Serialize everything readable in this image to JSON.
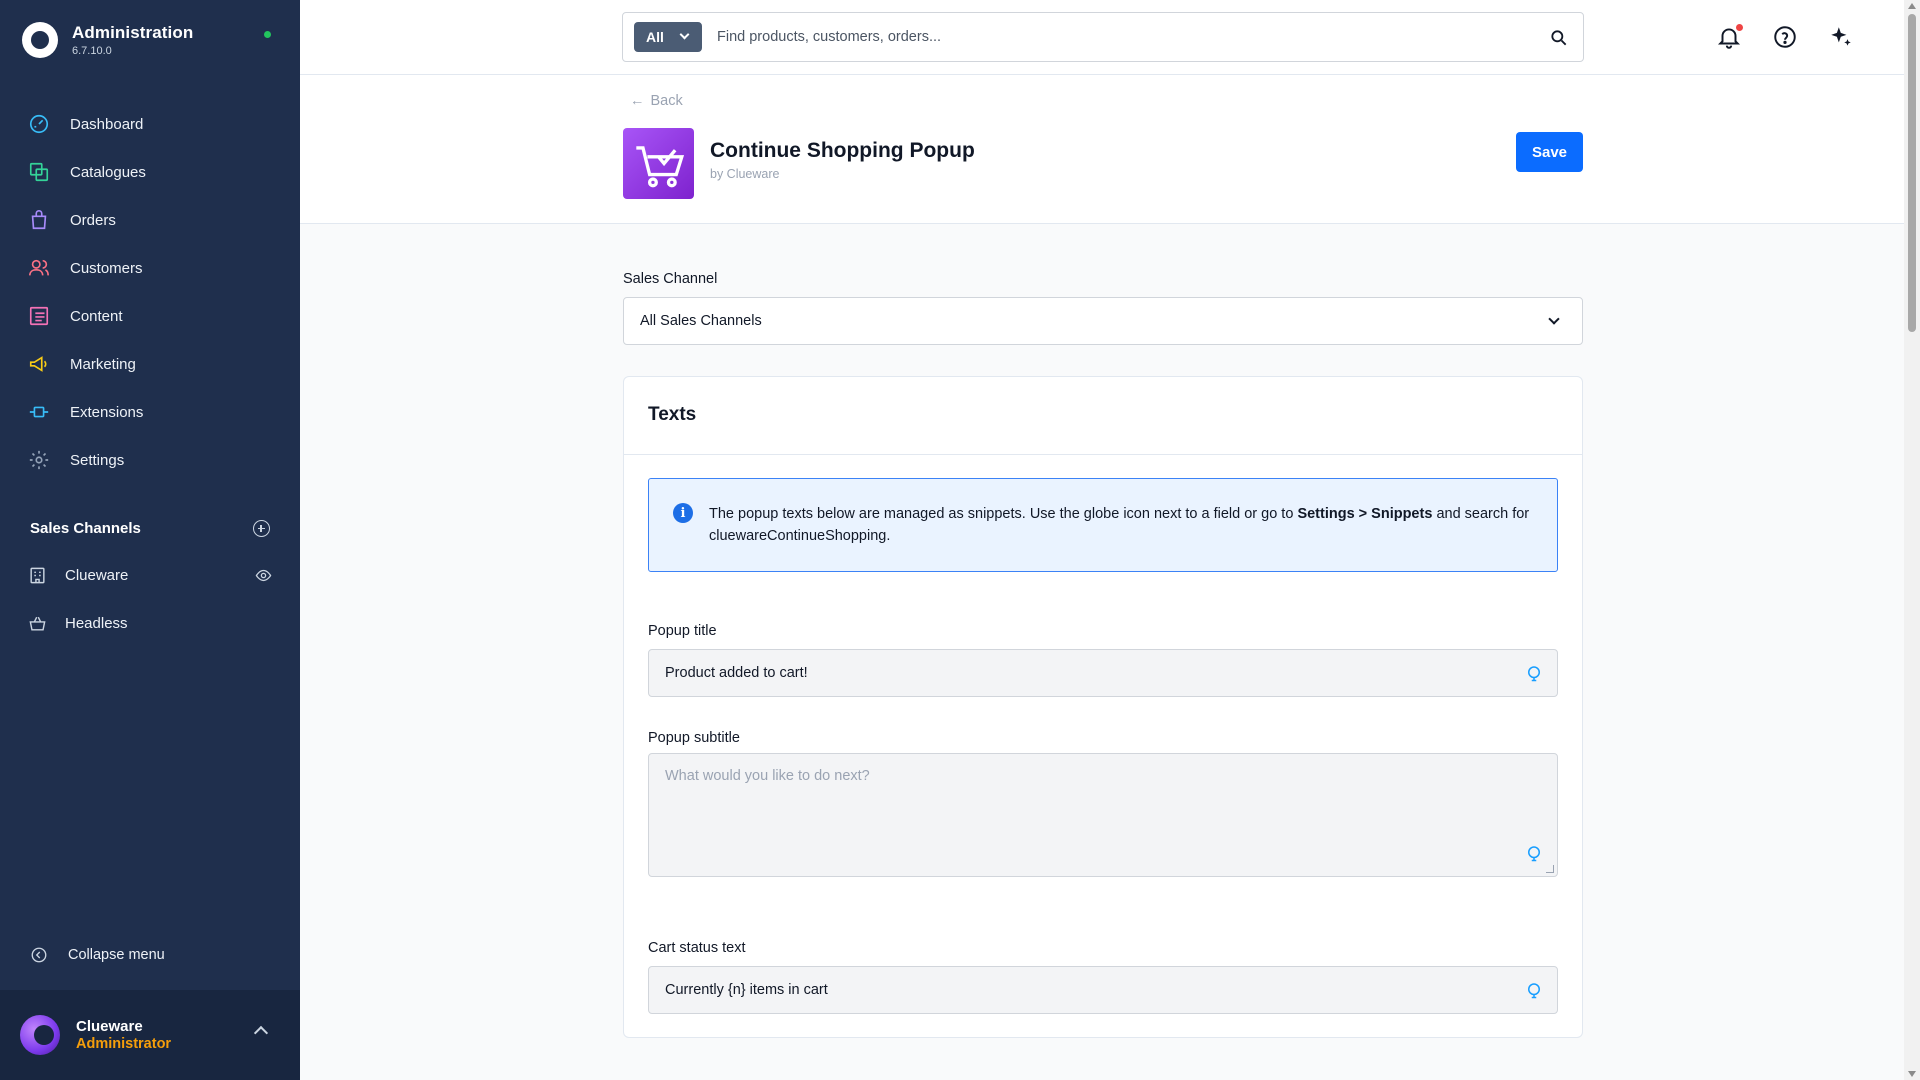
{
  "app": {
    "title": "Administration",
    "version": "6.7.10.0"
  },
  "sidebar": {
    "items": [
      {
        "label": "Dashboard",
        "icon": "dashboard-gauge-icon"
      },
      {
        "label": "Catalogues",
        "icon": "catalogue-icon"
      },
      {
        "label": "Orders",
        "icon": "shopping-bag-icon"
      },
      {
        "label": "Customers",
        "icon": "users-icon"
      },
      {
        "label": "Content",
        "icon": "content-layout-icon"
      },
      {
        "label": "Marketing",
        "icon": "megaphone-icon"
      },
      {
        "label": "Extensions",
        "icon": "plug-icon"
      },
      {
        "label": "Settings",
        "icon": "gear-icon"
      }
    ],
    "sales_channels_title": "Sales Channels",
    "sales_channels": [
      {
        "label": "Clueware",
        "icon": "storefront-icon"
      },
      {
        "label": "Headless",
        "icon": "basket-icon"
      }
    ],
    "collapse_label": "Collapse menu",
    "user": {
      "name": "Clueware",
      "role": "Administrator"
    }
  },
  "topbar": {
    "search_scope": "All",
    "search_placeholder": "Find products, customers, orders..."
  },
  "header": {
    "back_label": "Back",
    "title": "Continue Shopping Popup",
    "by": "by Clueware",
    "save_label": "Save"
  },
  "form": {
    "sales_channel_label": "Sales Channel",
    "sales_channel_value": "All Sales Channels",
    "card_title": "Texts",
    "info_text_1": "The popup texts below are managed as snippets. Use the globe icon next to a field or go to",
    "info_bold": "Settings > Snippets",
    "info_text_2": "and search for cluewareContinueShopping.",
    "popup_title_label": "Popup title",
    "popup_title_value": "Product added to cart!",
    "popup_subtitle_label": "Popup subtitle",
    "popup_subtitle_placeholder": "What would you like to do next?",
    "cart_status_label": "Cart status text",
    "cart_status_value": "Currently {n} items in cart"
  },
  "colors": {
    "sidebar": "#1f2f4d",
    "primary": "#0b6cff",
    "info_border": "#3b82f6",
    "role": "#f59e0b"
  }
}
